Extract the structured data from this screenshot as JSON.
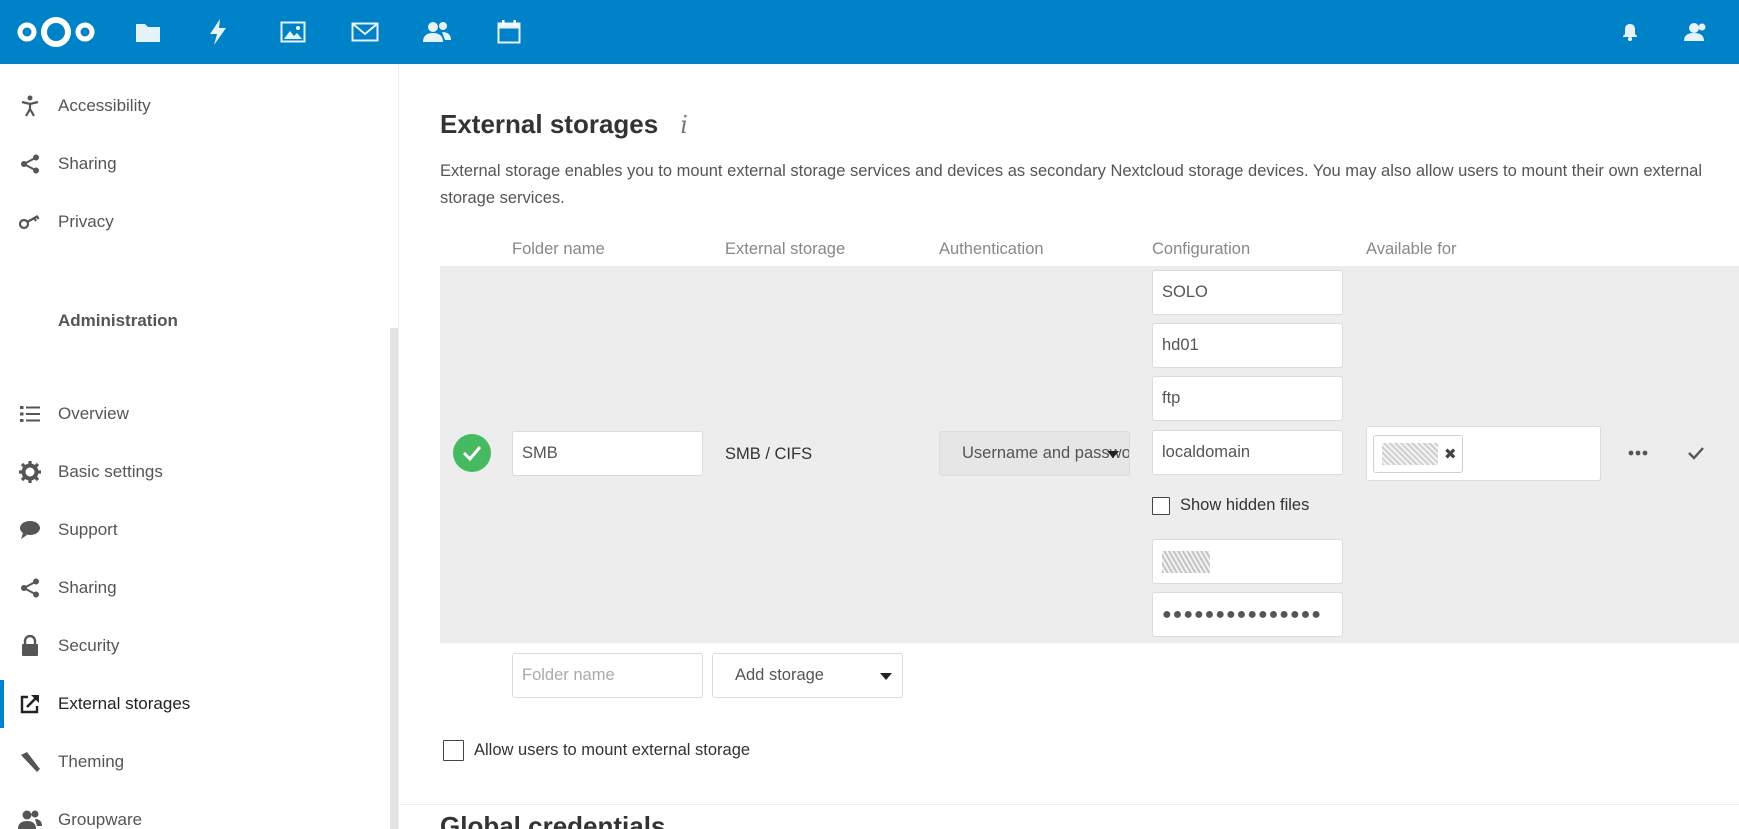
{
  "header": {
    "apps": [
      {
        "name": "files-icon"
      },
      {
        "name": "activity-icon"
      },
      {
        "name": "photos-icon"
      },
      {
        "name": "mail-icon"
      },
      {
        "name": "contacts-icon"
      },
      {
        "name": "calendar-icon"
      }
    ],
    "right": [
      {
        "name": "notifications-icon"
      },
      {
        "name": "user-menu-icon"
      }
    ],
    "color": "#0082c9"
  },
  "sidebar": {
    "personal_items": [
      {
        "label": "Accessibility",
        "icon": "accessibility-icon"
      },
      {
        "label": "Sharing",
        "icon": "share-icon"
      },
      {
        "label": "Privacy",
        "icon": "key-icon"
      }
    ],
    "admin_heading": "Administration",
    "admin_items": [
      {
        "label": "Overview",
        "icon": "list-icon"
      },
      {
        "label": "Basic settings",
        "icon": "gear-icon"
      },
      {
        "label": "Support",
        "icon": "speech-bubble-icon"
      },
      {
        "label": "Sharing",
        "icon": "share-icon"
      },
      {
        "label": "Security",
        "icon": "lock-icon"
      },
      {
        "label": "External storages",
        "icon": "external-link-icon",
        "active": true
      },
      {
        "label": "Theming",
        "icon": "brush-icon"
      },
      {
        "label": "Groupware",
        "icon": "group-icon"
      }
    ]
  },
  "main": {
    "title": "External storages",
    "info_icon_glyph": "i",
    "description": "External storage enables you to mount external storage services and devices as secondary Nextcloud storage devices. You may also allow users to mount their own external storage services.",
    "columns": [
      "Folder name",
      "External storage",
      "Authentication",
      "Configuration",
      "Available for"
    ],
    "mount": {
      "folder_name": "SMB",
      "backend": "SMB / CIFS",
      "authentication": "Username and password",
      "config": {
        "host": "SOLO",
        "share": "hd01",
        "subfolder": "ftp",
        "domain": "localdomain",
        "show_hidden_label": "Show hidden files",
        "password_mask": "●●●●●●●●●●●●●●●"
      },
      "status": "ok",
      "status_color": "#46ba61"
    },
    "new_row": {
      "folder_placeholder": "Folder name",
      "add_storage_label": "Add storage"
    },
    "allow_users_label": "Allow users to mount external storage",
    "next_section_title": "Global credentials"
  }
}
